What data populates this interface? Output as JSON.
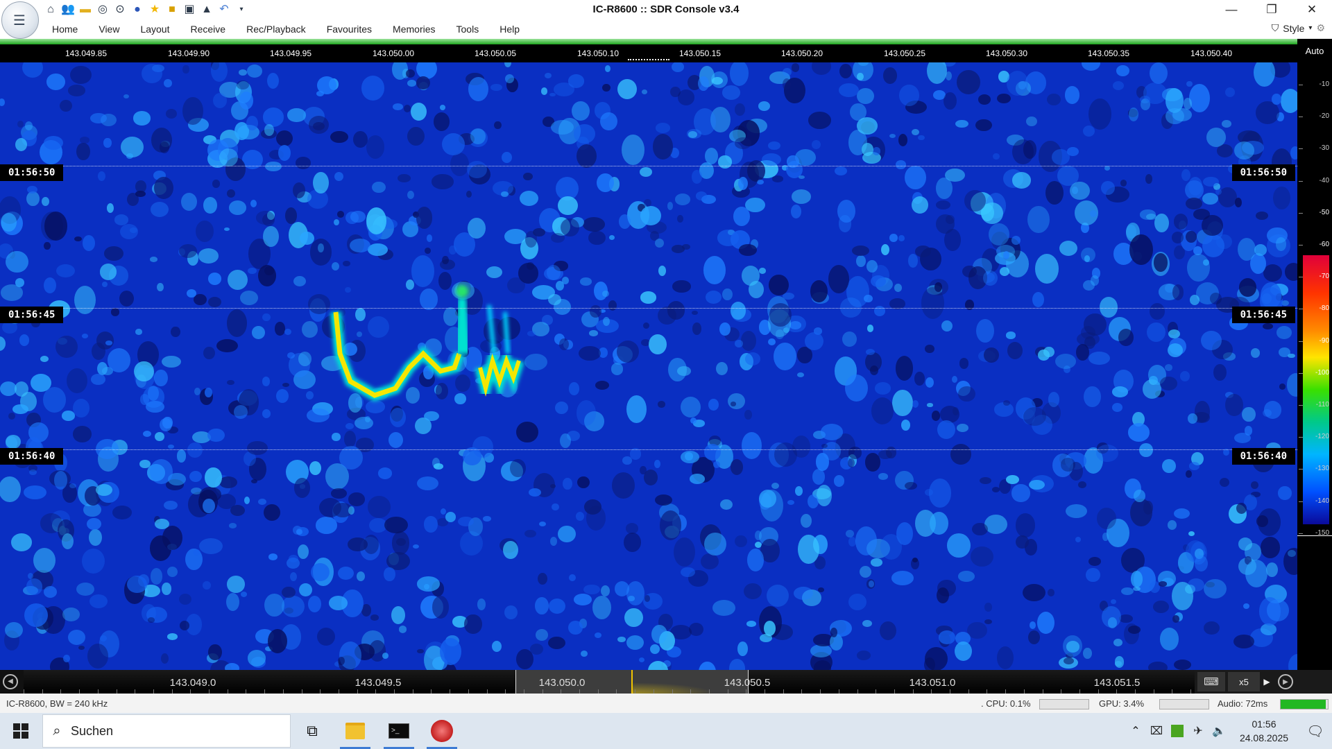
{
  "window": {
    "title": "IC-R8600 :: SDR Console v3.4",
    "controls": [
      "—",
      "❐",
      "✕"
    ]
  },
  "qat_icons": [
    "home-icon",
    "users-icon",
    "folder-icon",
    "play-icon",
    "stop-icon",
    "record-icon",
    "star-icon",
    "lock-icon",
    "camera-icon",
    "flask-icon",
    "undo-icon",
    "dropdown-icon"
  ],
  "menu": {
    "items": [
      "Home",
      "View",
      "Layout",
      "Receive",
      "Rec/Playback",
      "Favourites",
      "Memories",
      "Tools",
      "Help"
    ],
    "style_label": "Style"
  },
  "freq_top": {
    "labels": [
      "143.049.85",
      "143.049.90",
      "143.049.95",
      "143.050.00",
      "143.050.05",
      "143.050.10",
      "143.050.15",
      "143.050.20",
      "143.050.25",
      "143.050.30",
      "143.050.35",
      "143.050.40"
    ]
  },
  "waterfall": {
    "times": [
      "01:56:50",
      "01:56:45",
      "01:56:40"
    ]
  },
  "db_scale": {
    "auto_label": "Auto",
    "ticks": [
      "-10",
      "-20",
      "-30",
      "-40",
      "-50",
      "-60",
      "-70",
      "-80",
      "-90",
      "-100",
      "-110",
      "-120",
      "-130",
      "-140",
      "-150"
    ]
  },
  "freq_bottom": {
    "labels": [
      "143.049.0",
      "143.049.5",
      "143.050.0",
      "143.050.5",
      "143.051.0",
      "143.051.5"
    ],
    "zoom": "x5",
    "keyboard_glyph": "⌨",
    "arrow_glyph": "▶"
  },
  "status": {
    "device": "IC-R8600, BW = 240 kHz",
    "cpu": ". CPU: 0.1%",
    "gpu": "GPU: 3.4%",
    "audio": "Audio: 72ms",
    "audio_level": 0.95,
    "cpu_level": 0.0,
    "gpu_level": 0.0
  },
  "taskbar": {
    "search_label": "Suchen",
    "time": "01:56",
    "date": "24.08.2025"
  },
  "colors": {
    "waterfall_bg": "#0b34c8",
    "accent_green": "#1fa51f",
    "signal_yellow": "#f5e600",
    "taskbar_bg": "#dde6f0"
  }
}
